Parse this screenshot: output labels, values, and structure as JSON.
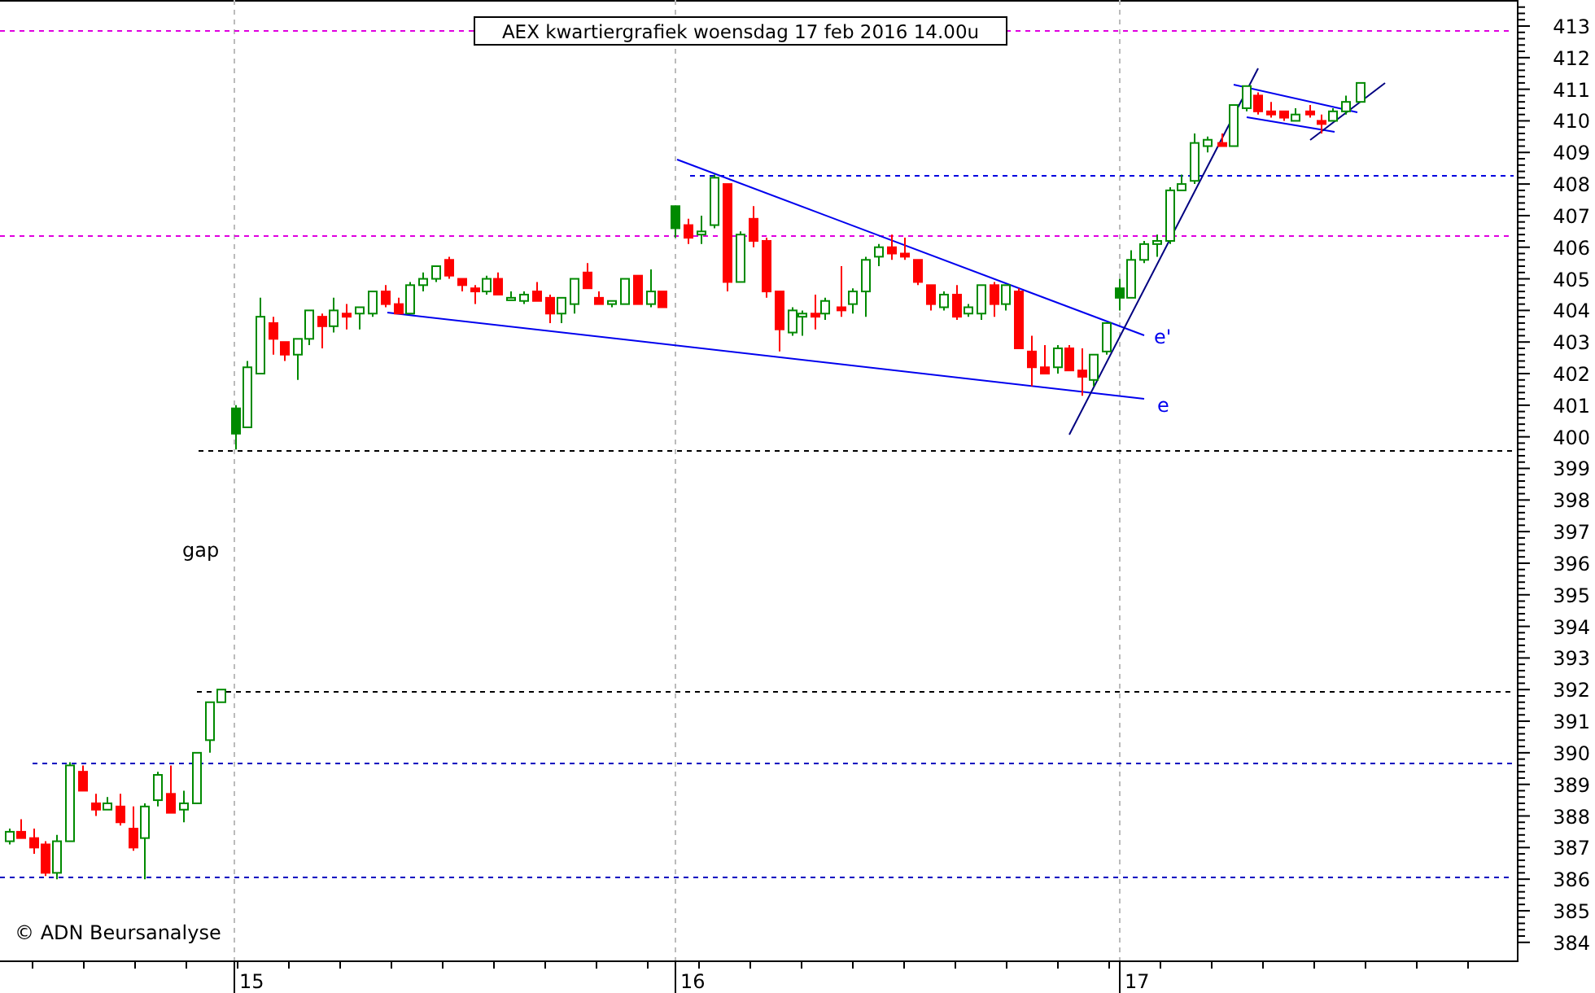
{
  "chart": {
    "title": "AEX kwartiergrafiek woensdag 17 feb 2016 14.00u",
    "y_axis_labels": [
      "413",
      "412",
      "411",
      "410",
      "409",
      "408",
      "407",
      "406",
      "405",
      "404",
      "403",
      "402",
      "401",
      "400",
      "399",
      "398",
      "397",
      "396",
      "395",
      "394",
      "393",
      "392",
      "391",
      "390",
      "389",
      "388",
      "387",
      "386",
      "385",
      "384"
    ],
    "x_axis_labels": [
      "15",
      "16",
      "17"
    ],
    "annotations": [
      {
        "kind": "gap",
        "text": "gap"
      },
      {
        "kind": "upper",
        "text": "e'"
      },
      {
        "kind": "lower",
        "text": "e"
      }
    ],
    "copyright": "© ADN Beursanalyse"
  }
}
